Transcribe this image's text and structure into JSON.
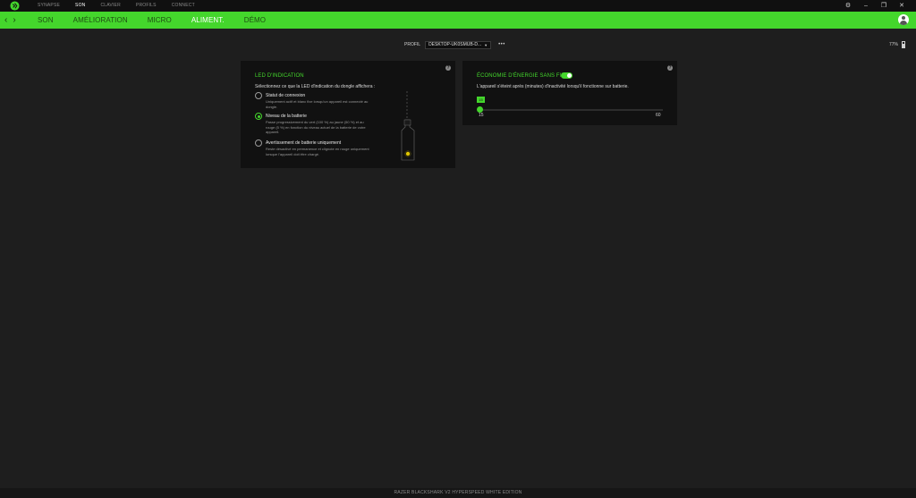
{
  "topnav": [
    "SYNAPSE",
    "SON",
    "CLAVIER",
    "PROFILS",
    "CONNECT"
  ],
  "topnav_active": "SON",
  "window_controls": {
    "settings": "⚙",
    "minimize": "–",
    "restore": "❐",
    "close": "✕"
  },
  "nav": {
    "back": "‹",
    "forward": "›"
  },
  "tabs": [
    "SON",
    "AMÉLIORATION",
    "MICRO",
    "ALIMENT.",
    "DÉMO"
  ],
  "tabs_active": "ALIMENT.",
  "profile": {
    "label": "PROFIL",
    "value": "DESKTOP-UK0SMUB-D...",
    "more": "•••"
  },
  "battery_level": "77%",
  "led_panel": {
    "title": "LED D'INDICATION",
    "description": "Sélectionnez ce que la LED d'indication du dongle affichera :",
    "info": "?",
    "options": [
      {
        "title": "Statut de connexion",
        "subtitle": "Uniquement actif et blanc fixe lorsqu'un appareil est connecté au dongle.",
        "checked": false
      },
      {
        "title": "Niveau de la batterie",
        "subtitle": "Passe progressivement du vert (100 %) au jaune (50 %) et au rouge (5 %) en fonction du niveau actuel de la batterie de votre appareil.",
        "checked": true
      },
      {
        "title": "Avertissement de batterie uniquement",
        "subtitle": "Reste désactivé en permanence et clignote en rouge uniquement lorsque l'appareil doit être chargé.",
        "checked": false
      }
    ]
  },
  "power_panel": {
    "title": "ÉCONOMIE D'ÉNERGIE SANS FIL",
    "toggle_on": true,
    "description": "L'appareil s'éteint après (minutes) d'inactivité lorsqu'il fonctionne sur batterie.",
    "info": "?",
    "slider": {
      "value": 15,
      "min": 15,
      "max": 60,
      "min_label": "15",
      "max_label": "60",
      "badge": "15"
    }
  },
  "footer": "RAZER BLACKSHARK V2 HYPERSPEED WHITE EDITION",
  "colors": {
    "accent": "#44d62c",
    "panel": "#111111",
    "background": "#1e1e1e"
  }
}
